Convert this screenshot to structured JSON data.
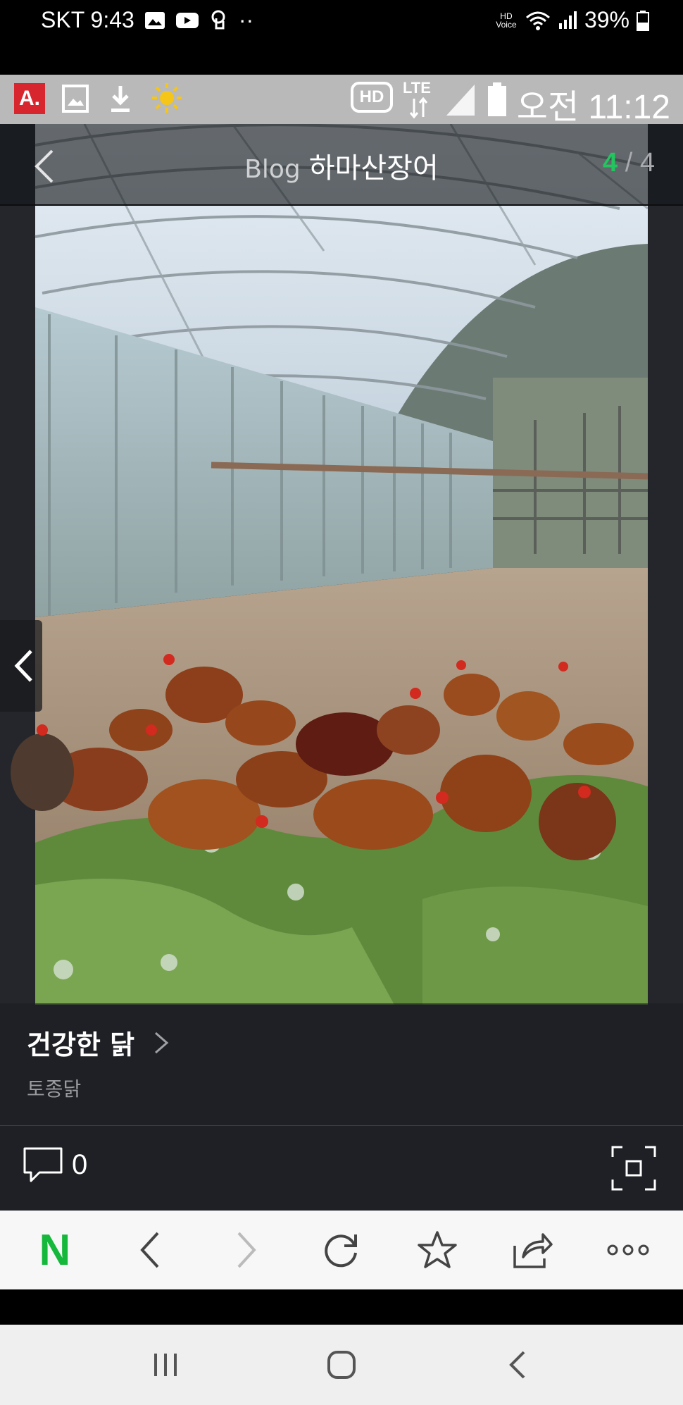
{
  "system_status": {
    "carrier_time": "SKT 9:43",
    "dots": "··",
    "hd_voice": "HD Voice",
    "battery": "39%"
  },
  "inner_status": {
    "app_badge": "A.",
    "hd": "HD",
    "lte": "LTE",
    "clock": "오전 11:12"
  },
  "viewer": {
    "blog_label": "Blog",
    "blog_name": "하마산장어",
    "counter_current": "4",
    "counter_sep": " / ",
    "counter_total": "4"
  },
  "caption": {
    "title": "건강한 닭",
    "subtitle": "토종닭"
  },
  "actions": {
    "comment_count": "0"
  },
  "browser_toolbar": {
    "logo": "N",
    "items": [
      "naver-home",
      "back",
      "forward",
      "reload",
      "bookmark",
      "share",
      "more"
    ]
  },
  "colors": {
    "accent_green": "#22c55e",
    "naver_green": "#16b83b",
    "acrobat_red": "#d8262e"
  }
}
